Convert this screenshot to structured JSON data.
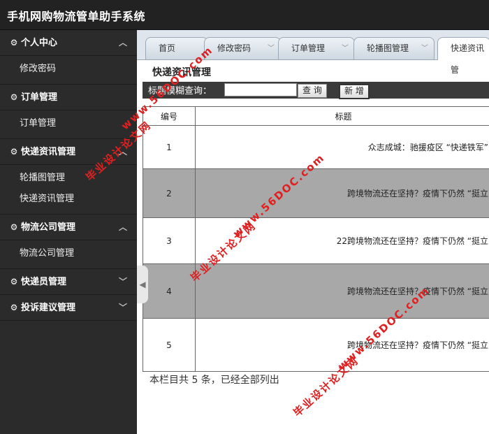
{
  "app": {
    "title": "手机网购物流管单助手系统"
  },
  "sidebar": {
    "groups": [
      {
        "label": "个人中心",
        "chevron": "up",
        "items": [
          "修改密码"
        ]
      },
      {
        "label": "订单管理",
        "chevron": "",
        "items": [
          "订单管理"
        ]
      },
      {
        "label": "快递资讯管理",
        "chevron": "up",
        "items": [
          "轮播图管理",
          "快递资讯管理"
        ]
      },
      {
        "label": "物流公司管理",
        "chevron": "up",
        "items": [
          "物流公司管理"
        ]
      },
      {
        "label": "快递员管理",
        "chevron": "down",
        "items": []
      },
      {
        "label": "投诉建议管理",
        "chevron": "down",
        "items": []
      }
    ]
  },
  "tabs": [
    {
      "label": "首页"
    },
    {
      "label": "修改密码"
    },
    {
      "label": "订单管理"
    },
    {
      "label": "轮播图管理"
    },
    {
      "label": "快递资讯管"
    }
  ],
  "main": {
    "section_title": "快递资讯管理",
    "search": {
      "label": "标题模糊查询：",
      "value": "",
      "search_button": "查 询",
      "add_button": "新 增"
    },
    "table": {
      "headers": [
        "编号",
        "标题"
      ],
      "rows": [
        {
          "no": "1",
          "title": "众志成城：驰援疫区 “快递铁军”"
        },
        {
          "no": "2",
          "title": "跨境物流还在坚持？疫情下仍然 “挺立"
        },
        {
          "no": "3",
          "title": "22跨境物流还在坚持？疫情下仍然 “挺立"
        },
        {
          "no": "4",
          "title": "跨境物流还在坚持？疫情下仍然 “挺立"
        },
        {
          "no": "5",
          "title": "跨境物流还在坚持？疫情下仍然 “挺立"
        }
      ]
    },
    "footer": "本栏目共 5 条，已经全部列出"
  },
  "watermarks": [
    "毕业设计论文网",
    "www.56DOC.com"
  ],
  "icons": {
    "group_icon": "gears-icon",
    "collapse_handle": "chevron-left-icon"
  },
  "colors": {
    "topbar": "#222222",
    "sidebar": "#2b2b2b",
    "watermark": "#e02020",
    "gray_row": "#a8a8a8"
  }
}
